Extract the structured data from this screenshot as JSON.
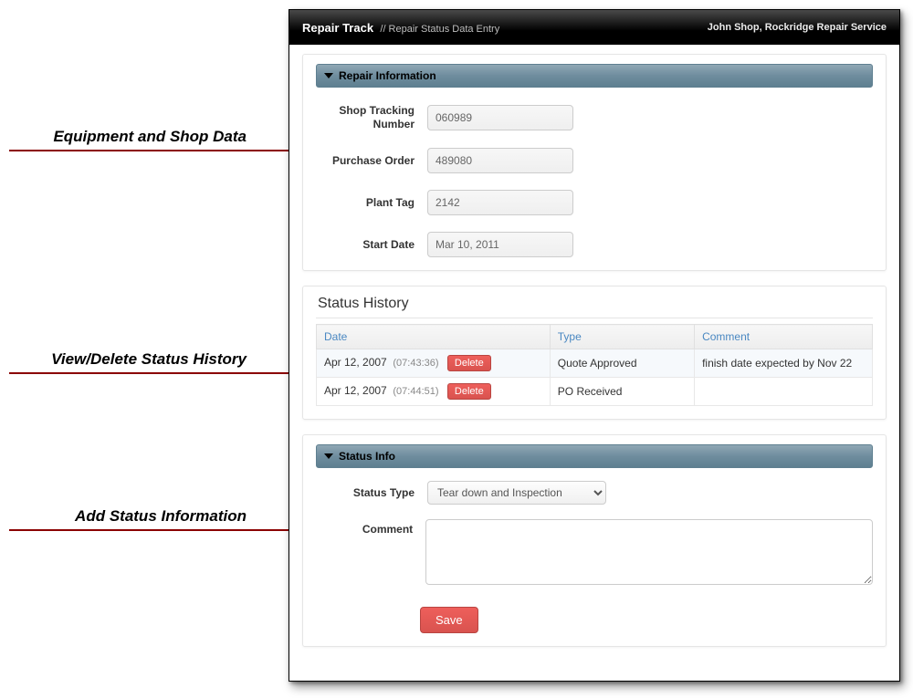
{
  "annotations": {
    "equip": "Equipment and Shop Data",
    "history": "View/Delete Status History",
    "add": "Add Status Information"
  },
  "header": {
    "brand": "Repair Track",
    "crumb": "// Repair Status Data Entry",
    "user": "John Shop, Rockridge Repair Service"
  },
  "repair_info": {
    "title": "Repair Information",
    "rows": [
      {
        "label": "Shop Tracking Number",
        "value": "060989"
      },
      {
        "label": "Purchase Order",
        "value": "489080"
      },
      {
        "label": "Plant Tag",
        "value": "2142"
      },
      {
        "label": "Start Date",
        "value": "Mar 10, 2011"
      }
    ]
  },
  "status_history": {
    "title": "Status History",
    "cols": {
      "date": "Date",
      "type": "Type",
      "comment": "Comment"
    },
    "rows": [
      {
        "date": "Apr 12, 2007",
        "time": "(07:43:36)",
        "delete": "Delete",
        "type": "Quote Approved",
        "comment": "finish date expected by Nov 22"
      },
      {
        "date": "Apr 12, 2007",
        "time": "(07:44:51)",
        "delete": "Delete",
        "type": "PO Received",
        "comment": ""
      }
    ]
  },
  "status_info": {
    "title": "Status Info",
    "type_label": "Status Type",
    "type_value": "Tear down and Inspection",
    "comment_label": "Comment",
    "save": "Save"
  }
}
